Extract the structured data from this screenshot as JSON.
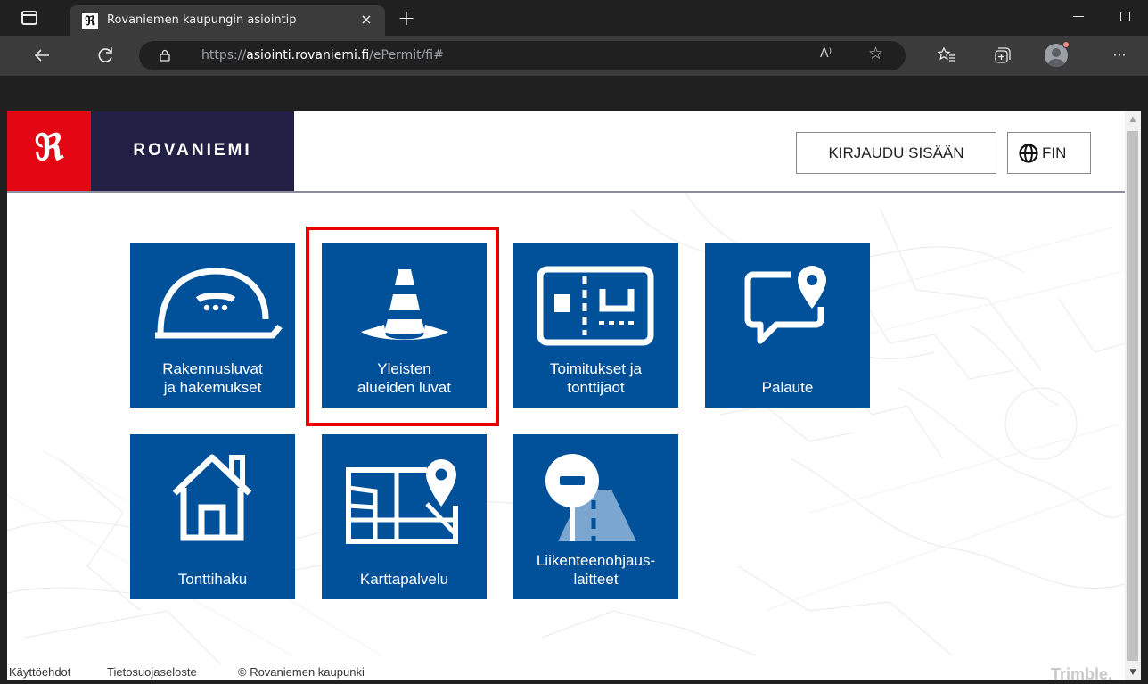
{
  "browser": {
    "tab_title": "Rovaniemen kaupungin asiointip",
    "tab_close": "×",
    "new_tab": "+",
    "url_scheme": "https://",
    "url_host": "asiointi.rovaniemi.fi",
    "url_path": "/ePermit/fi#",
    "read_aloud": "A⁾",
    "more": "···"
  },
  "header": {
    "logo_mark": "ℜ",
    "logo_text": "ROVANIEMI",
    "login_label": "KIRJAUDU SISÄÄN",
    "language_label": "FIN"
  },
  "tiles": [
    {
      "label": "Rakennusluvat\nja hakemukset",
      "icon": "helmet-icon"
    },
    {
      "label": "Yleisten\nalueiden luvat",
      "icon": "traffic-cone-icon"
    },
    {
      "label": "Toimitukset ja\ntonttijaot",
      "icon": "plot-division-icon"
    },
    {
      "label": "Palaute",
      "icon": "feedback-pin-icon"
    },
    {
      "label": "Tonttihaku",
      "icon": "house-icon"
    },
    {
      "label": "Karttapalvelu",
      "icon": "map-pin-icon"
    },
    {
      "label": "Liikenteenohjaus-\nlaitteet",
      "icon": "no-entry-sign-icon"
    }
  ],
  "highlighted_tile": "Yleisten alueiden luvat",
  "footer": {
    "terms": "Käyttöehdot",
    "privacy": "Tietosuojaseloste",
    "copyright": "© Rovaniemen kaupunki",
    "vendor": "Trimble."
  },
  "colors": {
    "tile_blue": "#00519a",
    "brand_red": "#e30613",
    "brand_navy": "#211f44",
    "highlight": "#e60000"
  }
}
